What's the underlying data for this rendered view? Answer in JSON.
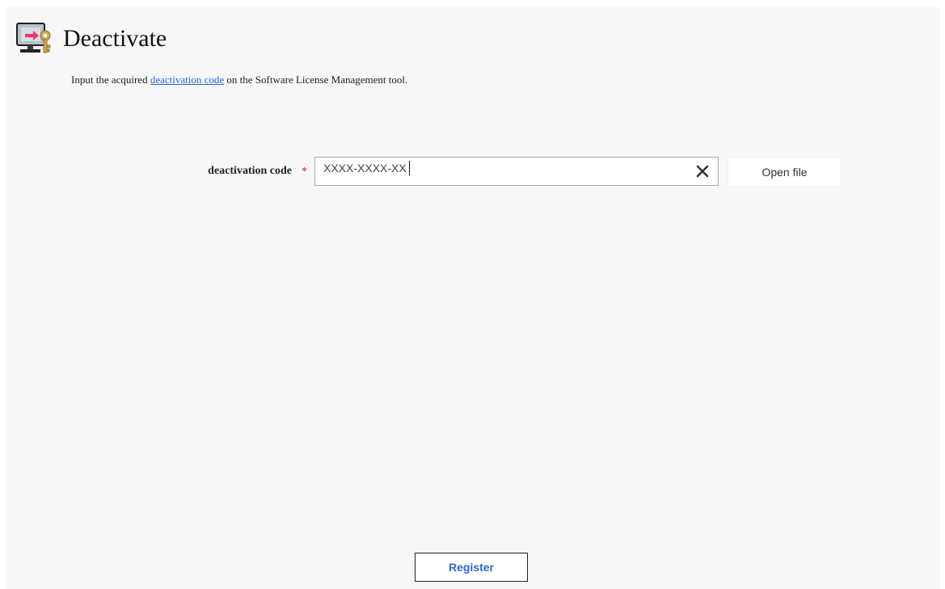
{
  "header": {
    "title": "Deactivate",
    "icon": "monitor-key-icon"
  },
  "description": {
    "before": "Input the acquired ",
    "link": "deactivation code",
    "after": " on the Software License Management tool."
  },
  "form": {
    "label": "deactivation code",
    "required_mark": "*",
    "input_value": "XXXX-XXXX-XX",
    "clear_icon": "close-icon",
    "open_file_label": "Open file"
  },
  "footer": {
    "register_label": "Register"
  },
  "colors": {
    "link": "#2f62d8",
    "required": "#c81b1b",
    "register_text": "#2f62d8",
    "panel_background": "#f7f7f7"
  }
}
